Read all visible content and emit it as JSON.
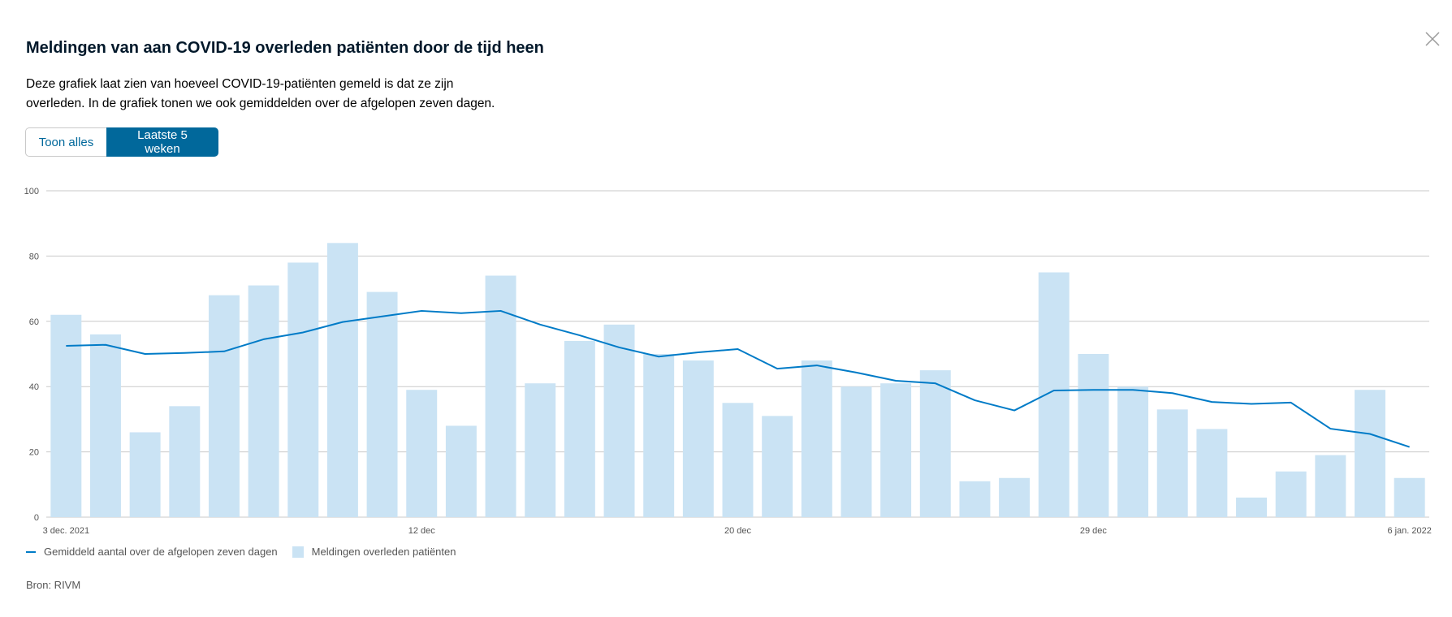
{
  "title": "Meldingen van aan COVID-19 overleden patiënten door de tijd heen",
  "description": "Deze grafiek laat zien van hoeveel COVID-19-patiënten gemeld is dat ze zijn overleden. In de grafiek tonen we ook gemiddelden over de afgelopen zeven dagen.",
  "toggle": {
    "all_label": "Toon alles",
    "recent_label": "Laatste 5 weken"
  },
  "legend": {
    "line_label": "Gemiddeld aantal over de afgelopen zeven dagen",
    "bar_label": "Meldingen overleden patiënten"
  },
  "source": "Bron: RIVM",
  "close_icon": "close-icon",
  "colors": {
    "bar": "#cae3f4",
    "line": "#007bc7",
    "grid": "#c9c9c9",
    "accent": "#01689b"
  },
  "chart_data": {
    "type": "bar",
    "ylim": [
      0,
      100
    ],
    "y_ticks": [
      0,
      20,
      40,
      60,
      80,
      100
    ],
    "x_tick_labels": [
      {
        "label": "3 dec. 2021",
        "index": 0
      },
      {
        "label": "12 dec",
        "index": 9
      },
      {
        "label": "20 dec",
        "index": 17
      },
      {
        "label": "29 dec",
        "index": 26
      },
      {
        "label": "6 jan. 2022",
        "index": 34
      }
    ],
    "series": [
      {
        "name": "Meldingen overleden patiënten",
        "kind": "bar",
        "values": [
          62,
          56,
          26,
          34,
          68,
          71,
          78,
          84,
          69,
          39,
          28,
          74,
          41,
          54,
          59,
          50,
          48,
          35,
          31,
          48,
          40,
          41,
          45,
          11,
          12,
          75,
          50,
          40,
          33,
          27,
          6,
          14,
          19,
          39,
          12
        ]
      },
      {
        "name": "Gemiddeld aantal over de afgelopen zeven dagen",
        "kind": "line",
        "values": [
          52.5,
          52.8,
          50,
          50.3,
          50.8,
          54.5,
          56.6,
          59.8,
          61.5,
          63.2,
          62.5,
          63.2,
          59,
          55.7,
          52,
          49.2,
          50.5,
          51.5,
          45.5,
          46.5,
          44.3,
          41.8,
          41,
          35.8,
          32.7,
          38.8,
          39,
          39,
          38,
          35.3,
          34.7,
          35.1,
          27.1,
          25.5,
          21.5
        ]
      }
    ]
  }
}
